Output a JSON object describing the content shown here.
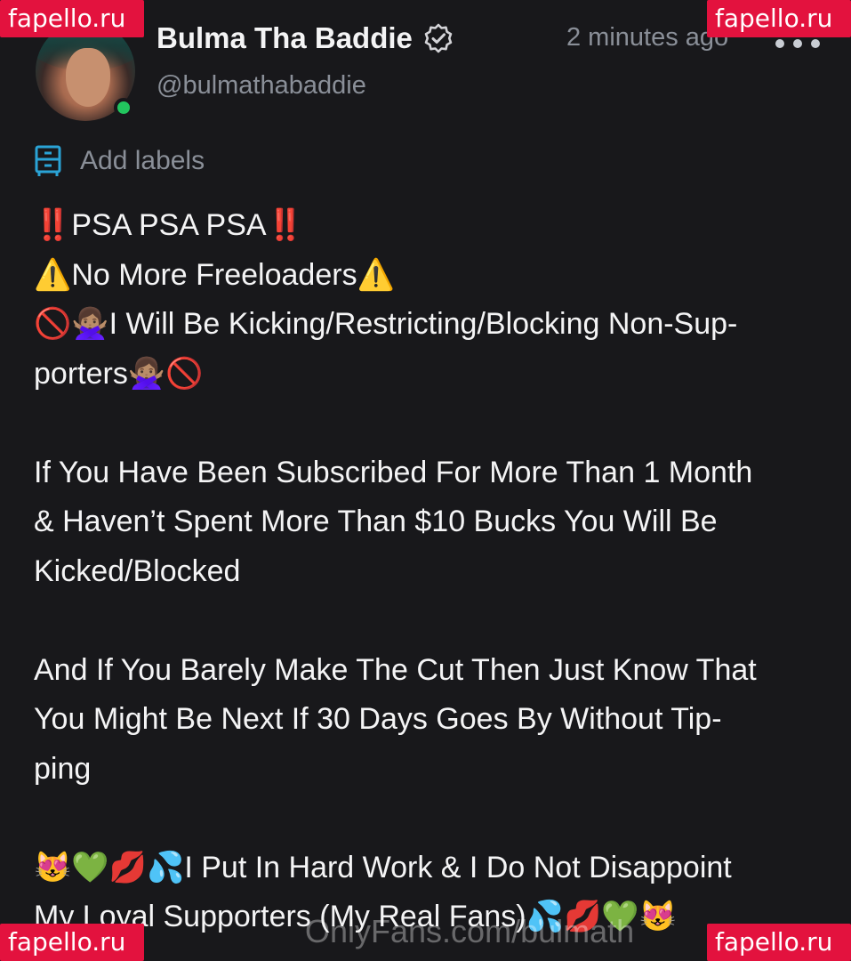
{
  "post": {
    "author": {
      "display_name": "Bulma Tha Baddie",
      "handle": "@bulmathabaddie",
      "verified": true,
      "online": true,
      "online_color": "#22c55e"
    },
    "timestamp": "2 minutes ago",
    "add_labels_text": "Add labels",
    "text_lines": [
      "‼️PSA PSA PSA‼️",
      "⚠️No More Freeloaders⚠️",
      "🚫🙅🏽‍♀️I Will Be Kicking/Restricting/Blocking Non-Sup-",
      "porters🙅🏽‍♀️🚫",
      "",
      "If You Have Been Subscribed For More Than 1 Month",
      "& Haven’t Spent More Than $10 Bucks You Will Be",
      "Kicked/Blocked",
      "",
      "And If You Barely Make The Cut Then Just Know That",
      "You Might Be Next If 30 Days Goes By Without Tip-",
      "ping",
      "",
      "😻💚💋💦I Put In Hard Work & I Do Not Disappoint",
      "My Loyal Supporters (My Real Fans)💦💋💚😻"
    ]
  },
  "watermarks": {
    "top_left": "fapello.ru",
    "top_right": "fapello.ru",
    "bottom_left": "fapello.ru",
    "bottom_right": "fapello.ru",
    "site_mark": "OnlyFans.com/bulmath"
  },
  "colors": {
    "background": "#18181b",
    "text": "#f4f4f5",
    "muted": "#8a8f98",
    "accent": "#2aa3d6",
    "watermark_bg": "#e3123e"
  },
  "icons": {
    "verified": "verified-badge-icon",
    "labels": "labels-icon",
    "more": "more-dots-icon"
  }
}
